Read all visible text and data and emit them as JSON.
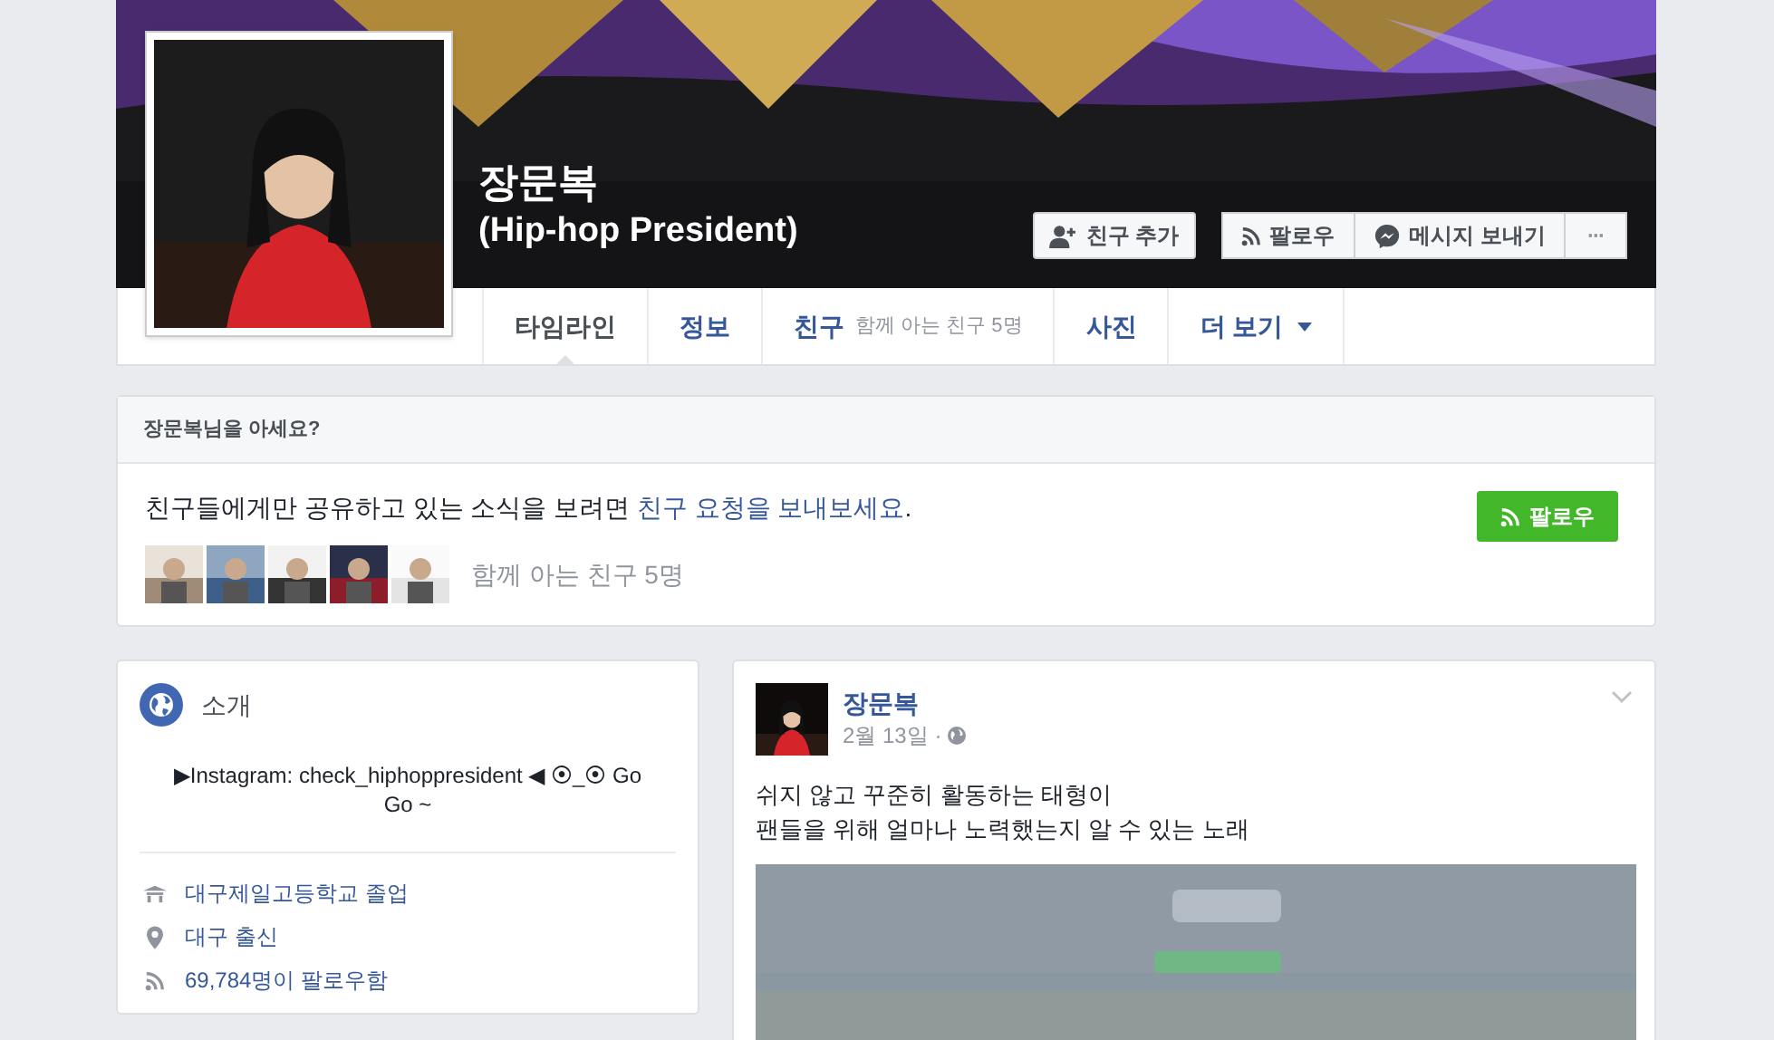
{
  "profile": {
    "name": "장문복",
    "subtitle": "(Hip-hop President)",
    "buttons": [
      {
        "kind": "add-friend",
        "label": "친구 추가"
      },
      {
        "kind": "follow",
        "label": "팔로우"
      },
      {
        "kind": "message",
        "label": "메시지 보내기"
      },
      {
        "kind": "more",
        "label": "···"
      }
    ],
    "tabs": [
      {
        "label": "타임라인",
        "selected": true
      },
      {
        "label": "정보",
        "selected": false
      },
      {
        "label": "친구",
        "note": "함께 아는 친구 5명",
        "selected": false
      },
      {
        "label": "사진",
        "selected": false
      },
      {
        "label": "더 보기",
        "dropdown": true,
        "selected": false
      }
    ]
  },
  "know_card": {
    "title": "장문복님을 아세요?",
    "message_before": "친구들에게만 공유하고 있는 소식을 보려면 ",
    "message_link": "친구 요청을 보내보세요",
    "message_after": ".",
    "follow_button": "팔로우",
    "mutual_friends": "함께 아는 친구 5명"
  },
  "intro": {
    "title": "소개",
    "bio": "▶Instagram: check_hiphoppresident ◀ ⦿_⦿ Go Go ~",
    "items": [
      {
        "kind": "school",
        "text": "대구제일고등학교 졸업"
      },
      {
        "kind": "place",
        "text": "대구 출신"
      },
      {
        "kind": "followers",
        "text": "69,784명이 팔로우함"
      }
    ]
  },
  "post": {
    "author": "장문복",
    "date": "2월 13일 ·",
    "lines": [
      "쉬지 않고 꾸준히 활동하는 태형이",
      "팬들을 위해 얼마나 노력했는지 알 수 있는 노래"
    ],
    "media": {
      "kind": "picture"
    }
  }
}
